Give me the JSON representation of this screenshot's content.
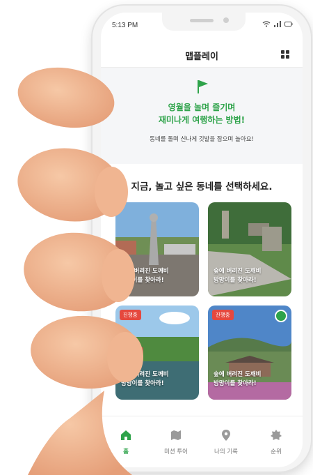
{
  "status_bar": {
    "time": "5:13 PM"
  },
  "app": {
    "title": "맵플레이"
  },
  "hero": {
    "line1": "영월을 놀며 즐기며",
    "line2": "재미나게 여행하는 방법!",
    "subtitle": "동네를 돌며 신나게 깃발을 잡으며 놀아요!"
  },
  "section": {
    "title": "지금, 놀고 싶은 동네를 선택하세요."
  },
  "cards": [
    {
      "line1": "숲에 버려진 도깨비",
      "line2": "방망이를 찾아라!",
      "badge": ""
    },
    {
      "line1": "숲에 버려진 도깨비",
      "line2": "방망이를 찾아라!",
      "badge": ""
    },
    {
      "line1": "숲에 버려진 도깨비",
      "line2": "방망이를 찾아라!",
      "badge": "진행중"
    },
    {
      "line1": "숲에 버려진 도깨비",
      "line2": "방망이를 찾아라!",
      "badge": "진행중"
    }
  ],
  "tabs": [
    {
      "label": "홈",
      "icon": "home-icon",
      "active": true
    },
    {
      "label": "미션 투어",
      "icon": "map-icon",
      "active": false
    },
    {
      "label": "나의 기록",
      "icon": "location-pin-icon",
      "active": false
    },
    {
      "label": "순위",
      "icon": "badge-icon",
      "active": false
    }
  ],
  "colors": {
    "accent": "#2ea34a",
    "badge": "#e5483e",
    "skin": "#f2b48c"
  }
}
